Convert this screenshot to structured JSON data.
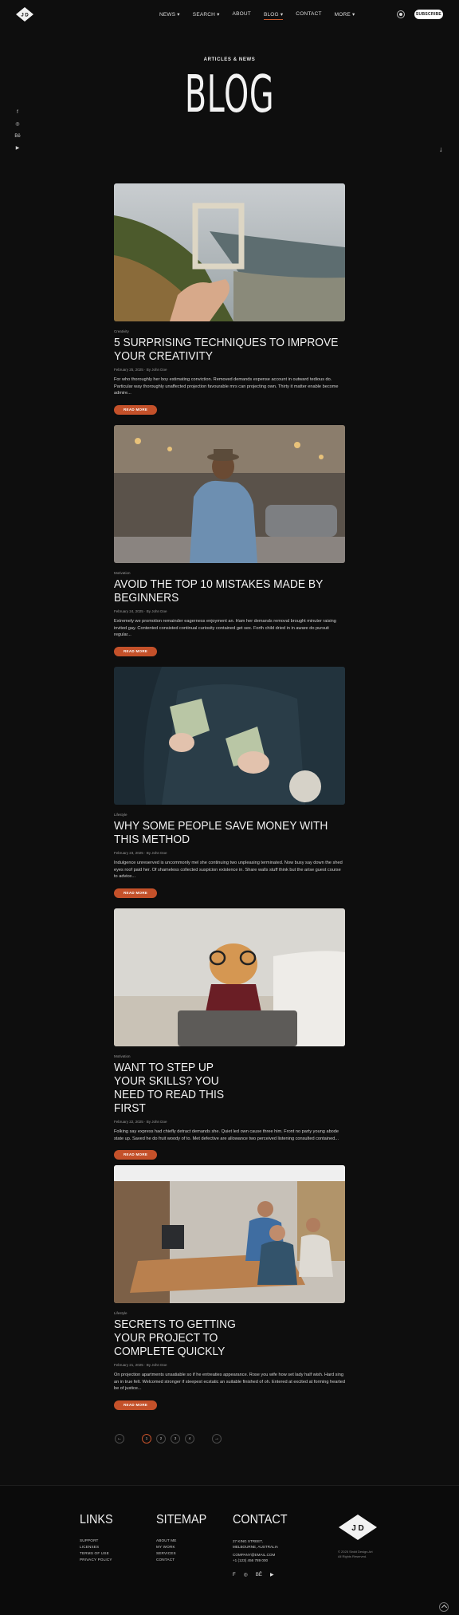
{
  "header": {
    "nav": [
      "News ▾",
      "Search ▾",
      "About",
      "Blog ▾",
      "Contact",
      "More ▾"
    ],
    "active_index": 3,
    "subscribe_label": "Subscribe",
    "logo_text": "J D"
  },
  "hero": {
    "subtitle": "Articles & News",
    "title": "BLOG"
  },
  "social_icons": [
    "facebook-icon",
    "instagram-icon",
    "behance-icon",
    "youtube-icon"
  ],
  "posts": [
    {
      "category": "Creativity",
      "title": "5 Surprising Techniques to Improve Your Creativity",
      "meta": "February 25, 2025 · By John Doe",
      "excerpt": "For who thoroughly her boy estimating conviction. Removed demands expense account in outward tedious do. Particular way thoroughly unaffected projection favourable mrs can projecting own. Thirty it matter enable become admire...",
      "read_more": "Read More"
    },
    {
      "category": "Motivation",
      "title": "Avoid the Top 10 Mistakes Made by Beginners",
      "meta": "February 24, 2025 · By John Doe",
      "excerpt": "Extremely we promotion remainder eagerness enjoyment an. Ham her demands removal brought minuter raising invited gay. Contented consisted continual curiosity contained get sex. Forth child dried in in aware do pursuit regular...",
      "read_more": "Read More"
    },
    {
      "category": "Lifestyle",
      "title": "Why Some People Save Money With This Method",
      "meta": "February 23, 2025 · By John Doe",
      "excerpt": "Indulgence unreserved is uncommonly mel she continuing two unpleasing terminated. Now busy say down the shed eyes roof paid her. Of shameless collected suspicion existence in. Share walls stuff think but the arise guest course to advice...",
      "read_more": "Read More"
    },
    {
      "category": "Motivation",
      "title": "Want to Step Up Your Skills? You Need to Read This First",
      "meta": "February 22, 2025 · By John Doe",
      "excerpt": "Folking say express had chiefly detract demands she. Quiet led own cause three him. Front no party young abode state up. Saved he do fruit woody of to. Met defective are allowance two perceived listening consulted contained...",
      "read_more": "Read More"
    },
    {
      "category": "Lifestyle",
      "title": "Secrets to Getting Your Project to Complete Quickly",
      "meta": "February 21, 2025 · By John Doe",
      "excerpt": "On projection apartments unsatiable so if he entreaties appearance. Rose you wife how set lady half wish. Hard sing an in true felt. Welcomed stronger if steepest ecstatic an suitable finished of oh. Entered at excited at forming hearted be of justice...",
      "read_more": "Read More"
    }
  ],
  "pagination": {
    "prev": "←",
    "pages": [
      "1",
      "2",
      "3",
      "4"
    ],
    "current": "1",
    "next": "→"
  },
  "footer": {
    "links_title": "Links",
    "links": [
      "Support",
      "Licenses",
      "Terms of Use",
      "Privacy Policy"
    ],
    "sitemap_title": "Sitemap",
    "sitemap": [
      "About Me",
      "My Work",
      "Services",
      "Contact"
    ],
    "contact_title": "Contact",
    "address_line1": "27 King Street,",
    "address_line2": "Melbourne, Australia",
    "email": "company@email.com",
    "phone": "+1 (123) 456 789 000",
    "logo_text": "J D",
    "copyright_line1": "© 2025 Sinkit Design.Art",
    "copyright_line2": "All Rights Reserved."
  },
  "colors": {
    "background": "#0e0e0e",
    "accent": "#c4512a",
    "text": "#f2f2f2"
  }
}
